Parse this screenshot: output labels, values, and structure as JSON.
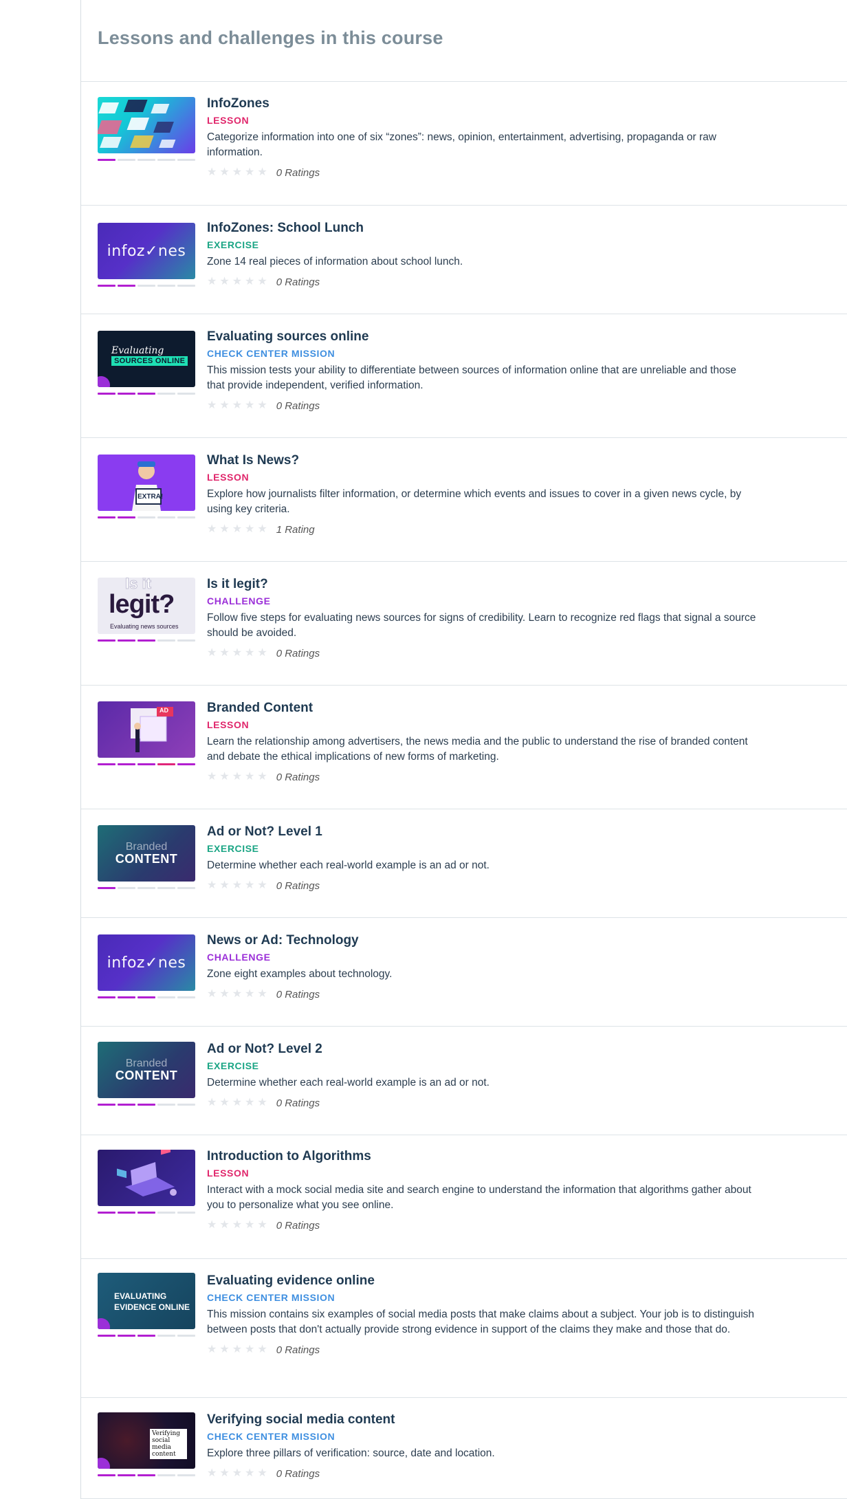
{
  "section": {
    "title": "Lessons and challenges in this course"
  },
  "colors": {
    "lesson": "#e0266b",
    "exercise": "#1aa584",
    "check_center_mission": "#3f8fe0",
    "challenge": "#9b2fd8",
    "progress_done": "#b21fd1"
  },
  "items": [
    {
      "title": "InfoZones",
      "type": "LESSON",
      "type_key": "lesson",
      "desc": "Categorize information into one of six “zones”: news, opinion, entertainment, advertising, propaganda or raw information.",
      "rating": "0 Ratings",
      "progress": [
        1,
        0,
        0,
        0,
        0
      ],
      "thumb": "devices"
    },
    {
      "title": "InfoZones: School Lunch",
      "type": "EXERCISE",
      "type_key": "exercise",
      "desc": "Zone 14 real pieces of information about school lunch.",
      "rating": "0 Ratings",
      "progress": [
        1,
        1,
        0,
        0,
        0
      ],
      "thumb": "infozones",
      "thumb_text": "infoz✓nes"
    },
    {
      "title": "Evaluating sources online",
      "type": "CHECK CENTER MISSION",
      "type_key": "check_center_mission",
      "desc": "This mission tests your ability to differentiate between sources of information online that are unreliable and those that provide independent, verified information.",
      "rating": "0 Ratings",
      "progress": [
        1,
        1,
        1,
        0,
        0
      ],
      "thumb": "eval-sources",
      "thumb_text_1": "Evaluating",
      "thumb_text_2": "SOURCES ONLINE"
    },
    {
      "title": "What Is News?",
      "type": "LESSON",
      "type_key": "lesson",
      "desc": "Explore how journalists filter information, or determine which events and issues to cover in a given news cycle, by using key criteria.",
      "rating": "1 Rating",
      "progress": [
        1,
        1,
        0,
        0,
        0
      ],
      "thumb": "extra",
      "thumb_text": "EXTRA!"
    },
    {
      "title": "Is it legit?",
      "type": "CHALLENGE",
      "type_key": "challenge",
      "desc": "Follow five steps for evaluating news sources for signs of credibility. Learn to recognize red flags that signal a source should be avoided.",
      "rating": "0 Ratings",
      "progress": [
        1,
        1,
        1,
        0,
        0
      ],
      "thumb": "legit",
      "thumb_text_1": "Is it",
      "thumb_text_2": "legit?",
      "thumb_text_3": "Evaluating news sources"
    },
    {
      "title": "Branded Content",
      "type": "LESSON",
      "type_key": "lesson",
      "desc": "Learn the relationship among advertisers, the news media and the public to understand the rise of branded content and debate the ethical implications of new forms of marketing.",
      "rating": "0 Ratings",
      "progress": [
        1,
        1,
        1,
        2,
        1
      ],
      "thumb": "branded-lesson",
      "thumb_text": "AD"
    },
    {
      "title": "Ad or Not? Level 1",
      "type": "EXERCISE",
      "type_key": "exercise",
      "desc": "Determine whether each real-world example is an ad or not.",
      "rating": "0 Ratings",
      "progress": [
        1,
        0,
        0,
        0,
        0
      ],
      "thumb": "branded",
      "thumb_text_1": "Branded",
      "thumb_text_2": "CONTENT"
    },
    {
      "title": "News or Ad: Technology",
      "type": "CHALLENGE",
      "type_key": "challenge",
      "desc": "Zone eight examples about technology.",
      "rating": "0 Ratings",
      "progress": [
        1,
        1,
        1,
        0,
        0
      ],
      "thumb": "infozones",
      "thumb_text": "infoz✓nes"
    },
    {
      "title": "Ad or Not? Level 2",
      "type": "EXERCISE",
      "type_key": "exercise",
      "desc": "Determine whether each real-world example is an ad or not.",
      "rating": "0 Ratings",
      "progress": [
        1,
        1,
        1,
        0,
        0
      ],
      "thumb": "branded",
      "thumb_text_1": "Branded",
      "thumb_text_2": "CONTENT"
    },
    {
      "title": "Introduction to Algorithms",
      "type": "LESSON",
      "type_key": "lesson",
      "desc": "Interact with a mock social media site and search engine to understand the information that algorithms gather about you to personalize what you see online.",
      "rating": "0 Ratings",
      "progress": [
        1,
        1,
        1,
        0,
        0
      ],
      "thumb": "algorithms"
    },
    {
      "title": "Evaluating evidence online",
      "type": "CHECK CENTER MISSION",
      "type_key": "check_center_mission",
      "desc": "This mission contains six examples of social media posts that make claims about a subject. Your job is to distinguish between posts that don't actually provide strong evidence in support of the claims they make and those that do.",
      "rating": "0 Ratings",
      "progress": [
        1,
        1,
        1,
        0,
        0
      ],
      "thumb": "eval-evidence",
      "thumb_text_1": "EVALUATING",
      "thumb_text_2": "EVIDENCE ONLINE"
    },
    {
      "title": "Verifying social media content",
      "type": "CHECK CENTER MISSION",
      "type_key": "check_center_mission",
      "desc": "Explore three pillars of verification: source, date and location.",
      "rating": "0 Ratings",
      "progress": [
        1,
        1,
        1,
        0,
        0
      ],
      "thumb": "verifying",
      "thumb_text": "Verifying social media content"
    }
  ]
}
